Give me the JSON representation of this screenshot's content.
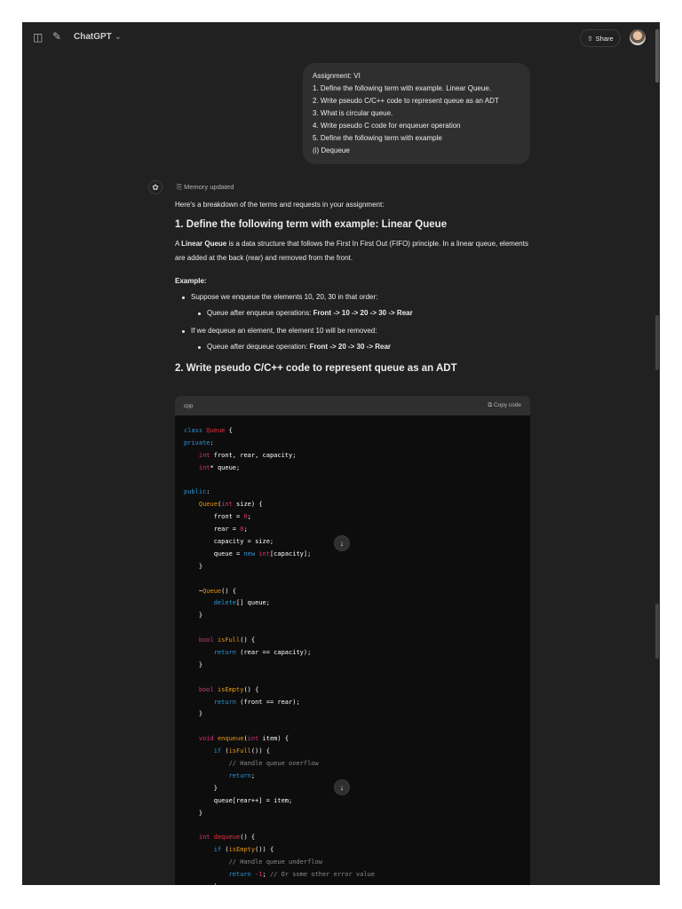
{
  "header": {
    "title": "ChatGPT",
    "share_label": "Share"
  },
  "user_message": {
    "lines": [
      "Assignment: VI",
      "1. Define the following term with example. Linear Queue.",
      "2. Write pseudo C/C++ code to represent queue as an ADT",
      "3. What is circular queue.",
      "4. Write pseudo C code for enqueuer operation",
      "5. Define the following term with example",
      "(i) Dequeue"
    ]
  },
  "response": {
    "memory": "Memory updated",
    "intro": "Here's a breakdown of the terms and requests in your assignment:",
    "h1": "1. Define the following term with example: ",
    "h1_bold": "Linear Queue",
    "p1_bold": "Linear Queue",
    "p1_pre": "A ",
    "p1": " is a data structure that follows the First In First Out (FIFO) principle. In a linear queue, elements are added at the back (rear) and removed from the front.",
    "example": "Example:",
    "b1": "Suppose we enqueue the elements 10, 20, 30 in that order:",
    "b1a": "Queue after enqueue operations: ",
    "b1a_bold": "Front -> 10 -> 20 -> 30 -> Rear",
    "b2": "If we dequeue an element, the element 10 will be removed:",
    "b2a": "Queue after dequeue operation: ",
    "b2a_bold": "Front -> 20 -> 30 -> Rear",
    "h2": "2. Write pseudo C/C++ code to represent queue as an ADT"
  },
  "code_block": {
    "language": "cpp",
    "copy_label": "Copy code",
    "lines": [
      [
        [
          "class ",
          "k"
        ],
        [
          "Queue",
          "c"
        ],
        [
          " {",
          ""
        ]
      ],
      [
        [
          "private",
          "k"
        ],
        [
          ":",
          ""
        ]
      ],
      [
        [
          "    ",
          ""
        ],
        [
          "int",
          "t"
        ],
        [
          " front, rear, capacity;",
          ""
        ]
      ],
      [
        [
          "    ",
          ""
        ],
        [
          "int",
          "t"
        ],
        [
          "* queue;",
          ""
        ]
      ],
      [],
      [
        [
          "public",
          "k"
        ],
        [
          ":",
          ""
        ]
      ],
      [
        [
          "    ",
          ""
        ],
        [
          "Queue",
          "f"
        ],
        [
          "(",
          ""
        ],
        [
          "int",
          "t"
        ],
        [
          " size) {",
          ""
        ]
      ],
      [
        [
          "        front = ",
          ""
        ],
        [
          "0",
          "n"
        ],
        [
          ";",
          ""
        ]
      ],
      [
        [
          "        rear = ",
          ""
        ],
        [
          "0",
          "n"
        ],
        [
          ";",
          ""
        ]
      ],
      [
        [
          "        capacity = size;",
          ""
        ]
      ],
      [
        [
          "        queue = ",
          ""
        ],
        [
          "new",
          "k"
        ],
        [
          " ",
          ""
        ],
        [
          "int",
          "t"
        ],
        [
          "[capacity];",
          ""
        ]
      ],
      [
        [
          "    }",
          ""
        ]
      ],
      [],
      [
        [
          "    ~",
          ""
        ],
        [
          "Queue",
          "f"
        ],
        [
          "() {",
          ""
        ]
      ],
      [
        [
          "        ",
          ""
        ],
        [
          "delete",
          "k"
        ],
        [
          "[] queue;",
          ""
        ]
      ],
      [
        [
          "    }",
          ""
        ]
      ],
      [],
      [
        [
          "    ",
          ""
        ],
        [
          "bool",
          "t"
        ],
        [
          " ",
          ""
        ],
        [
          "isFull",
          "f"
        ],
        [
          "() {",
          ""
        ]
      ],
      [
        [
          "        ",
          ""
        ],
        [
          "return",
          "k"
        ],
        [
          " (rear == capacity);",
          ""
        ]
      ],
      [
        [
          "    }",
          ""
        ]
      ],
      [],
      [
        [
          "    ",
          ""
        ],
        [
          "bool",
          "t"
        ],
        [
          " ",
          ""
        ],
        [
          "isEmpty",
          "f"
        ],
        [
          "() {",
          ""
        ]
      ],
      [
        [
          "        ",
          ""
        ],
        [
          "return",
          "k"
        ],
        [
          " (front == rear);",
          ""
        ]
      ],
      [
        [
          "    }",
          ""
        ]
      ],
      [],
      [
        [
          "    ",
          ""
        ],
        [
          "void",
          "t"
        ],
        [
          " ",
          ""
        ],
        [
          "enqueue",
          "f"
        ],
        [
          "(",
          ""
        ],
        [
          "int",
          "t"
        ],
        [
          " item) {",
          ""
        ]
      ],
      [
        [
          "        ",
          ""
        ],
        [
          "if",
          "k"
        ],
        [
          " (",
          ""
        ],
        [
          "isFull",
          "f"
        ],
        [
          "()) {",
          ""
        ]
      ],
      [
        [
          "            ",
          ""
        ],
        [
          "// Handle queue overflow",
          "cm"
        ]
      ],
      [
        [
          "            ",
          ""
        ],
        [
          "return",
          "k"
        ],
        [
          ";",
          ""
        ]
      ],
      [
        [
          "        }",
          ""
        ]
      ],
      [
        [
          "        queue[rear++] = item;",
          ""
        ]
      ],
      [
        [
          "    }",
          ""
        ]
      ],
      [],
      [
        [
          "    ",
          ""
        ],
        [
          "int",
          "t"
        ],
        [
          " ",
          ""
        ],
        [
          "dequeue",
          "c"
        ],
        [
          "() {",
          ""
        ]
      ],
      [
        [
          "        ",
          ""
        ],
        [
          "if",
          "k"
        ],
        [
          " (",
          ""
        ],
        [
          "isEmpty",
          "f"
        ],
        [
          "()) {",
          ""
        ]
      ],
      [
        [
          "            ",
          ""
        ],
        [
          "// Handle queue underflow",
          "cm"
        ]
      ],
      [
        [
          "            ",
          ""
        ],
        [
          "return",
          "k"
        ],
        [
          " ",
          ""
        ],
        [
          "-1",
          "n"
        ],
        [
          "; ",
          ""
        ],
        [
          "// Or some other error value",
          "cm"
        ]
      ],
      [
        [
          "        }",
          ""
        ]
      ]
    ]
  }
}
